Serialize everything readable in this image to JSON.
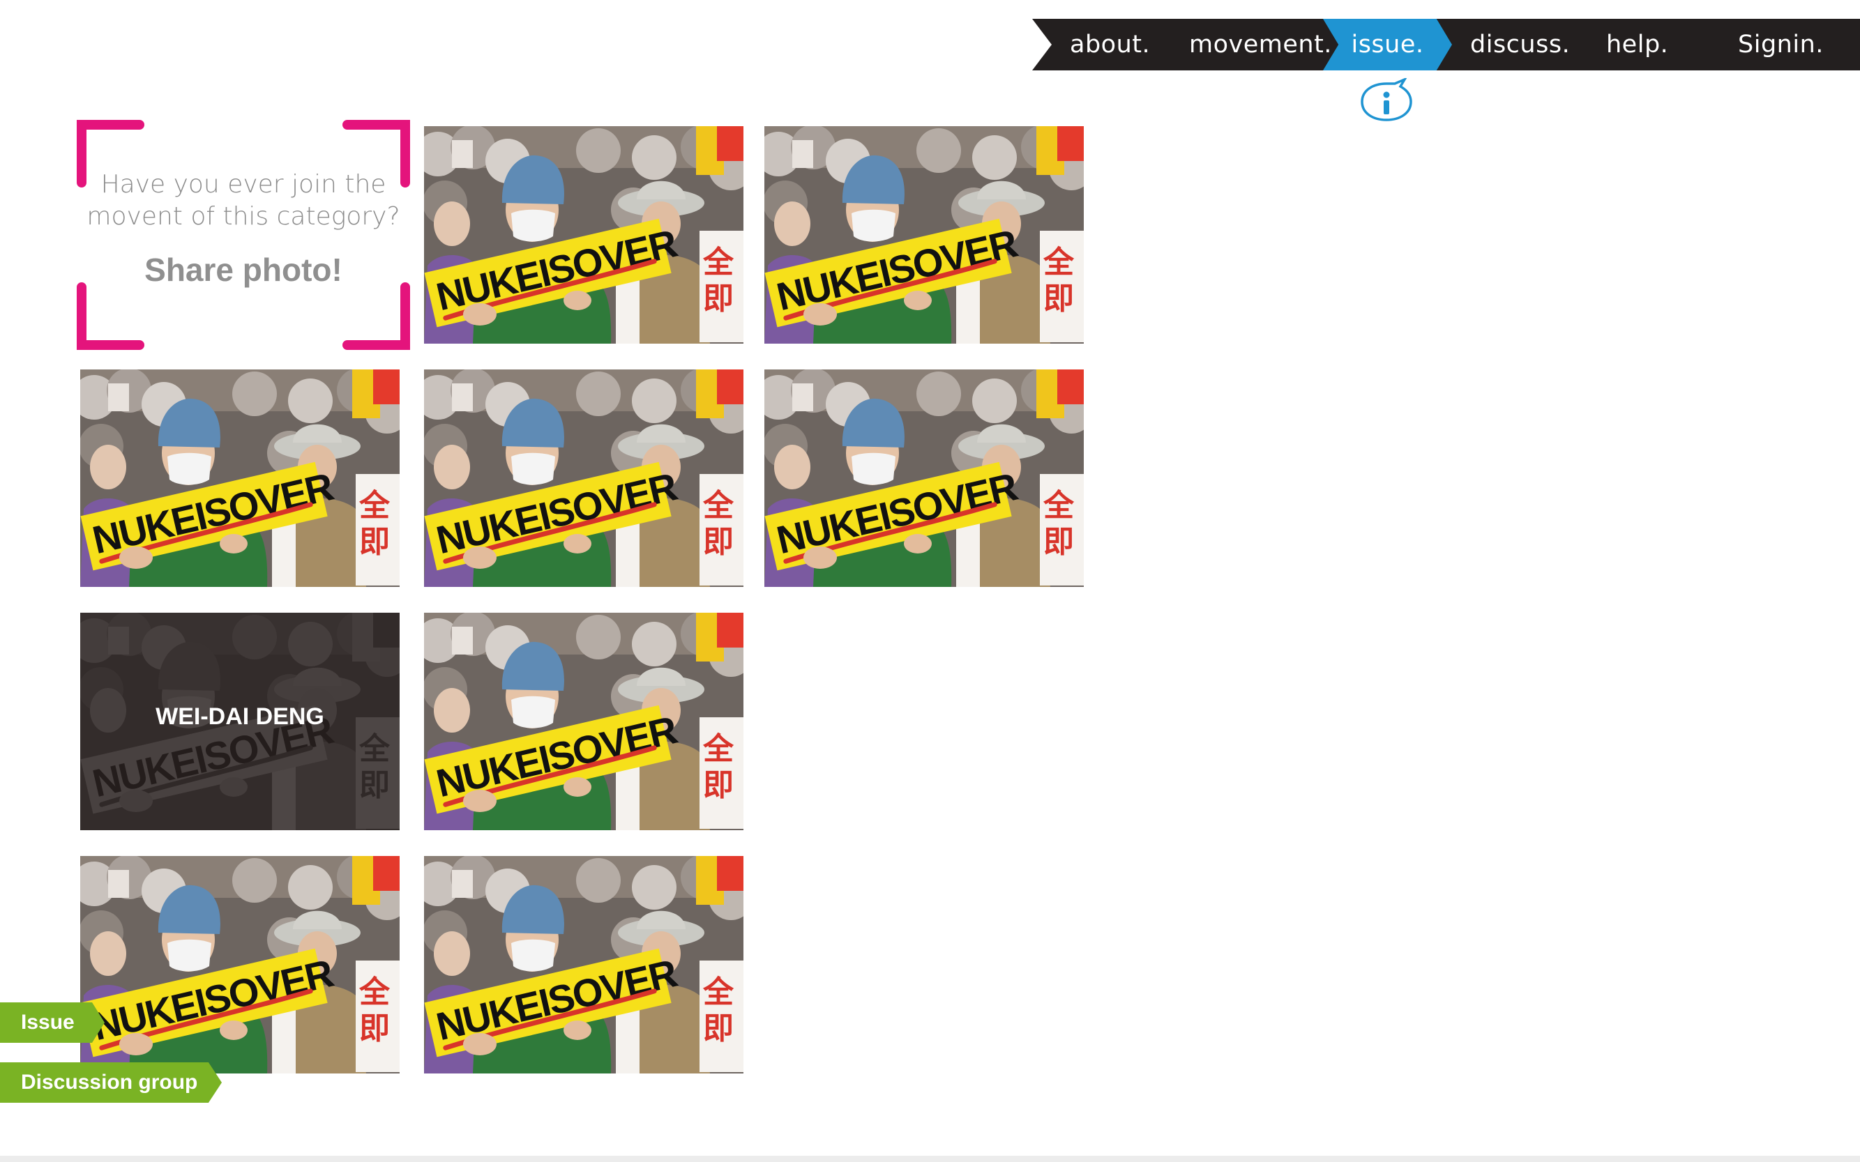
{
  "nav": {
    "items": [
      {
        "label": "about.",
        "active": false
      },
      {
        "label": "movement.",
        "active": false
      },
      {
        "label": "issue.",
        "active": true
      },
      {
        "label": "discuss.",
        "active": false
      },
      {
        "label": "help.",
        "active": false
      },
      {
        "label": "Signin.",
        "active": false
      }
    ],
    "info_icon": "info-icon"
  },
  "share": {
    "question_line1": "Have you ever join the",
    "question_line2": "movent of this category?",
    "cta": "Share photo!"
  },
  "tiles": [
    {
      "sign_text": "NUKEISOVER",
      "caption": ""
    },
    {
      "sign_text": "NUKEISOVER",
      "caption": ""
    },
    {
      "sign_text": "NUKEISOVER",
      "caption": ""
    },
    {
      "sign_text": "NUKEISOVER",
      "caption": ""
    },
    {
      "sign_text": "NUKEISOVER",
      "caption": ""
    },
    {
      "sign_text": "NUKEISOVER",
      "caption": "WEI-DAI DENG",
      "hovered": true
    },
    {
      "sign_text": "NUKEISOVER",
      "caption": ""
    },
    {
      "sign_text": "NUKEISOVER",
      "caption": ""
    },
    {
      "sign_text": "NUKEISOVER",
      "caption": ""
    }
  ],
  "side_sign_text": "全即",
  "tags": {
    "issue": "Issue",
    "discussion": "Discussion group"
  },
  "colors": {
    "nav_bg": "#231f1f",
    "nav_active": "#1f94d2",
    "frame_magenta": "#e4147c",
    "tag_green": "#7ab324",
    "sign_yellow": "#f6e01a"
  }
}
